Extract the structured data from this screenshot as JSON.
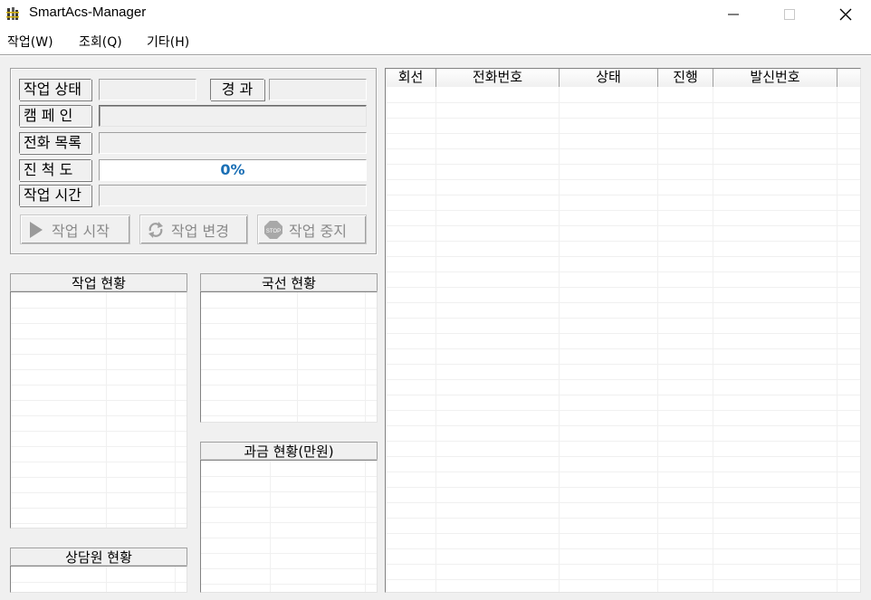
{
  "window": {
    "title": "SmartAcs-Manager",
    "minimize_glyph": "—",
    "maximize_glyph": "☐",
    "close_glyph": "✕",
    "app_icon": "bamboo-app-icon"
  },
  "menu": {
    "items": [
      "작업(W)",
      "조회(Q)",
      "기타(H)"
    ]
  },
  "job_panel": {
    "status_label": "작업 상태",
    "status_value": "",
    "elapsed_label": "경 과",
    "elapsed_value": "",
    "campaign_label": "캠 페 인",
    "campaign_value": "",
    "phonelist_label": "전화 목록",
    "phonelist_value": "",
    "progress_label": "진 척 도",
    "progress_value": "0%",
    "progress_fraction": 0,
    "jobtime_label": "작업 시간",
    "jobtime_value": "",
    "accent_color": "#1a6fb5"
  },
  "buttons": {
    "start": "작업 시작",
    "change": "작업 변경",
    "stop": "작업 중지",
    "start_icon": "play-icon",
    "change_icon": "refresh-icon",
    "stop_icon": "stop-sign-icon"
  },
  "panels": {
    "job_status": "작업 현황",
    "line_status": "국선 현황",
    "billing_status": "과금 현황(만원)",
    "agent_status": "상담원 현황"
  },
  "line_table": {
    "columns": [
      "회선",
      "전화번호",
      "상태",
      "진행",
      "발신번호"
    ]
  }
}
